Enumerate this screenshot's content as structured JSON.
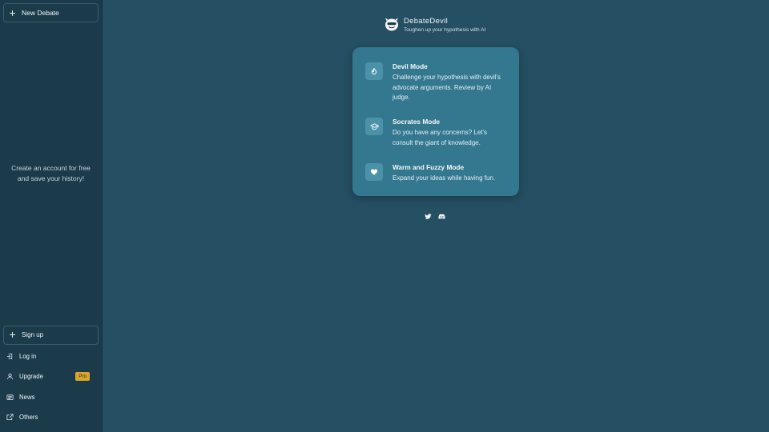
{
  "sidebar": {
    "new_debate_label": "New Debate",
    "promo_text": "Create an account for free and save your history!",
    "signup_label": "Sign up",
    "items": [
      {
        "label": "Log in",
        "icon": "login-icon"
      },
      {
        "label": "Upgrade",
        "icon": "user-icon",
        "badge": "Pro"
      },
      {
        "label": "News",
        "icon": "newspaper-icon"
      },
      {
        "label": "Others",
        "icon": "external-link-icon"
      }
    ]
  },
  "brand": {
    "name": "DebateDevil",
    "tagline": "Toughen up your hypothesis with AI"
  },
  "modes": [
    {
      "title": "Devil Mode",
      "description": "Challenge your hypothesis with devil's advocate arguments. Review by AI judge.",
      "icon": "flame-icon"
    },
    {
      "title": "Socrates Mode",
      "description": "Do you have any concerns? Let's consult the giant of knowledge.",
      "icon": "graduation-cap-icon"
    },
    {
      "title": "Warm and Fuzzy Mode",
      "description": "Expand your ideas while having fun.",
      "icon": "heart-icon"
    }
  ],
  "socials": [
    "twitter-icon",
    "discord-icon"
  ],
  "colors": {
    "background": "#254f62",
    "sidebar": "#1b3b4a",
    "card": "#33788f",
    "badge": "#d9a630"
  }
}
